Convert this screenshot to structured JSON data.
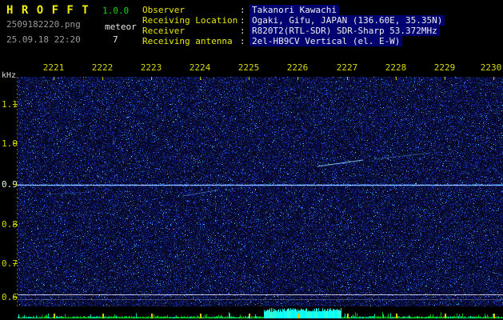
{
  "header": {
    "title": "H R O F F T",
    "version": "1.0.0",
    "filename": "2509182220.png",
    "mode": "meteor",
    "timestamp": "25.09.18 22:20",
    "count": "7",
    "colon": ":",
    "info": [
      {
        "label": "Observer",
        "value": "Takanori Kawachi"
      },
      {
        "label": "Receiving Location",
        "value": "Ogaki, Gifu, JAPAN (136.60E, 35.35N)"
      },
      {
        "label": "Receiver",
        "value": "R820T2(RTL-SDR) SDR-Sharp 53.372MHz"
      },
      {
        "label": "Receiving antenna",
        "value": "2el-HB9CV Vertical (el. E-W)"
      }
    ]
  },
  "spectrogram": {
    "y_unit": "kHz",
    "y_ticks": [
      "1.1",
      "1.0",
      "0.9",
      "0.8",
      "0.7",
      "0.6"
    ],
    "x_ticks": [
      "2221",
      "2222",
      "2223",
      "2224",
      "2225",
      "2226",
      "2227",
      "2228",
      "2229",
      "2230"
    ],
    "colors": {
      "background": "#000000",
      "noise_base": "#000a3c",
      "carrier_line_0_9khz": "#9fd0ff",
      "axis_tick": "#c8c800",
      "label_yellow": "#d6d600",
      "label_white": "#dcffdc",
      "level_green": "#00c020",
      "level_cyan": "#00ffff",
      "info_value_bg": "#000070",
      "info_label": "#e8e800",
      "title_yellow": "#f0f000",
      "version_green": "#00dd00"
    }
  }
}
